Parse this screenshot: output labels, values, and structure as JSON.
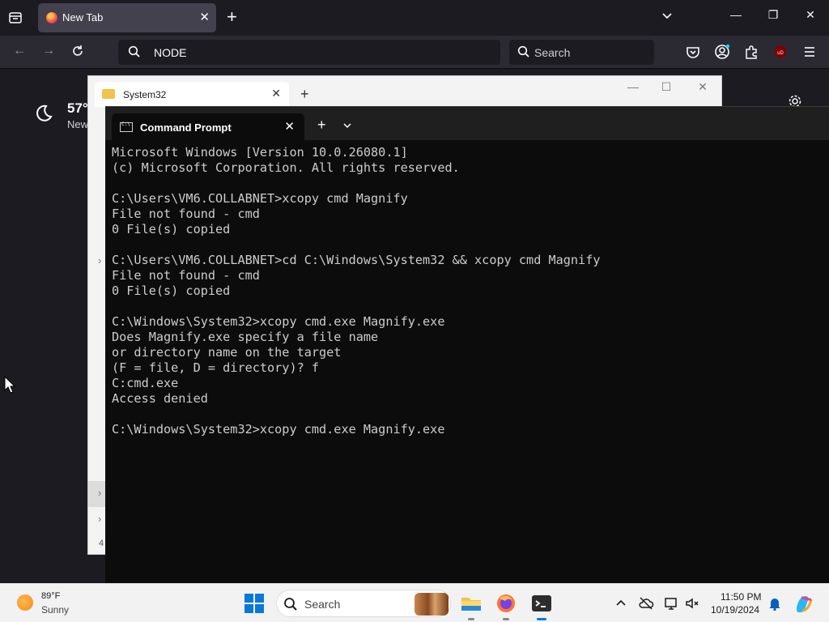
{
  "browser": {
    "tab_title": "New Tab",
    "url_value": "NODE",
    "search_placeholder": "Search"
  },
  "new_tab_page": {
    "temperature": "57°",
    "location": "New"
  },
  "explorer": {
    "tab_title": "System32",
    "sidebar_number": "4"
  },
  "terminal": {
    "tab_title": "Command Prompt",
    "lines": [
      "Microsoft Windows [Version 10.0.26080.1]",
      "(c) Microsoft Corporation. All rights reserved.",
      "",
      "C:\\Users\\VM6.COLLABNET>xcopy cmd Magnify",
      "File not found - cmd",
      "0 File(s) copied",
      "",
      "C:\\Users\\VM6.COLLABNET>cd C:\\Windows\\System32 && xcopy cmd Magnify",
      "File not found - cmd",
      "0 File(s) copied",
      "",
      "C:\\Windows\\System32>xcopy cmd.exe Magnify.exe",
      "Does Magnify.exe specify a file name",
      "or directory name on the target",
      "(F = file, D = directory)? f",
      "C:cmd.exe",
      "Access denied",
      "",
      "C:\\Windows\\System32>xcopy cmd.exe Magnify.exe"
    ]
  },
  "taskbar": {
    "weather_temp": "89°F",
    "weather_condition": "Sunny",
    "search_placeholder": "Search",
    "clock_time": "11:50 PM",
    "clock_date": "10/19/2024"
  },
  "colors": {
    "accent": "#0a78d7",
    "terminal_bg": "#0c0c0c",
    "terminal_fg": "#cccccc",
    "firefox_dark": "#1c1b22"
  }
}
